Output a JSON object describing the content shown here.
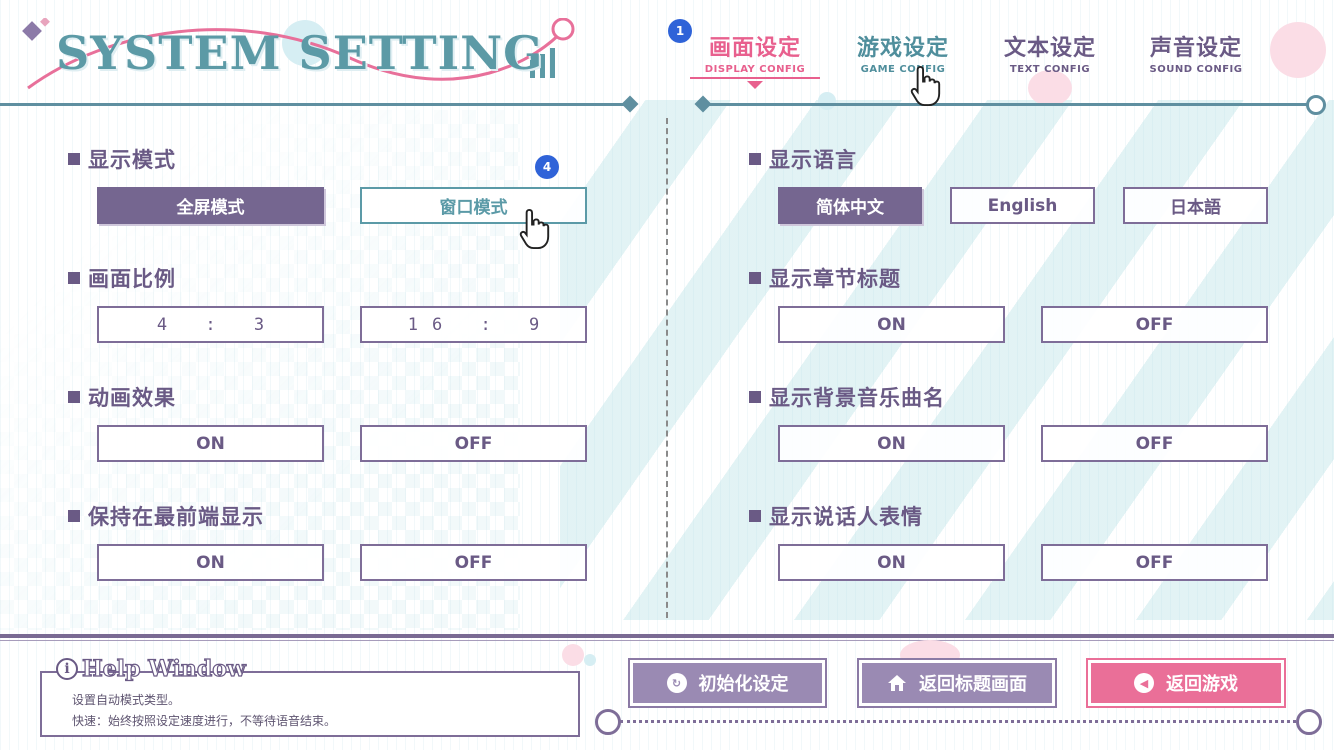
{
  "header": {
    "logo_text": "SYSTEM SETTING",
    "tabs": [
      {
        "label": "画面设定",
        "sub": "DISPLAY CONFIG"
      },
      {
        "label": "游戏设定",
        "sub": "GAME CONFIG"
      },
      {
        "label": "文本设定",
        "sub": "TEXT CONFIG"
      },
      {
        "label": "声音设定",
        "sub": "SOUND CONFIG"
      }
    ],
    "badge_1": "1"
  },
  "left": {
    "display_mode": {
      "title": "显示模式",
      "options": [
        "全屏模式",
        "窗口模式"
      ],
      "selected": "全屏模式"
    },
    "aspect": {
      "title": "画面比例",
      "options": [
        "4 : 3",
        "16 : 9"
      ]
    },
    "animation": {
      "title": "动画效果",
      "options": [
        "ON",
        "OFF"
      ]
    },
    "topmost": {
      "title": "保持在最前端显示",
      "options": [
        "ON",
        "OFF"
      ]
    },
    "badge_4": "4"
  },
  "right": {
    "language": {
      "title": "显示语言",
      "options": [
        "简体中文",
        "English",
        "日本語"
      ],
      "selected": "简体中文"
    },
    "chapter": {
      "title": "显示章节标题",
      "options": [
        "ON",
        "OFF"
      ]
    },
    "bgm_name": {
      "title": "显示背景音乐曲名",
      "options": [
        "ON",
        "OFF"
      ]
    },
    "expression": {
      "title": "显示说话人表情",
      "options": [
        "ON",
        "OFF"
      ]
    }
  },
  "footer": {
    "help_title": "Help Window",
    "help_lines": [
      "设置自动模式类型。",
      "快速：始终按照设定速度进行，不等待语音结束。"
    ],
    "buttons": {
      "reset": "初始化设定",
      "title": "返回标题画面",
      "back": "返回游戏"
    }
  },
  "colors": {
    "accent_pink": "#e8608e",
    "purple": "#756690",
    "teal": "#5f8fa0"
  }
}
